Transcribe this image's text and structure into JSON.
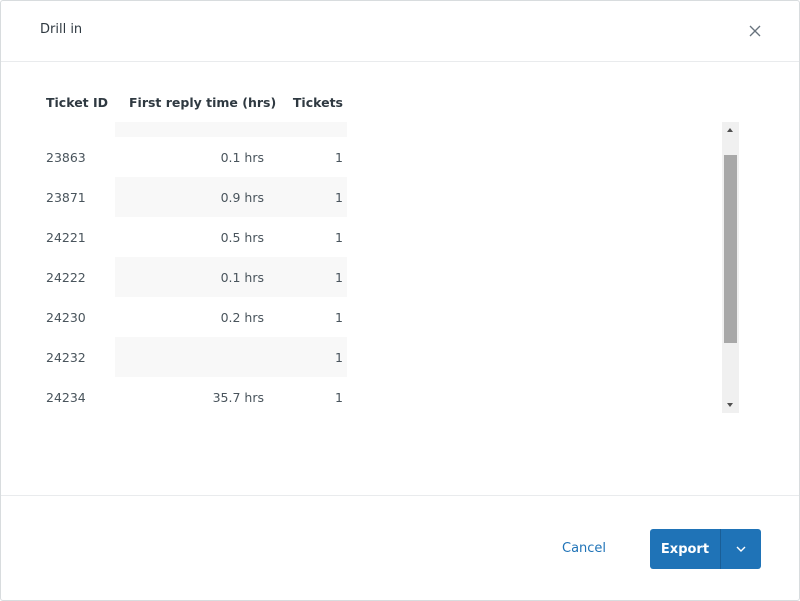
{
  "dialog": {
    "title": "Drill in",
    "close_icon": "close-icon"
  },
  "table": {
    "headers": {
      "ticket_id": "Ticket ID",
      "first_reply_time": "First reply time (hrs)",
      "tickets": "Tickets"
    },
    "rows": [
      {
        "ticket_id": "",
        "first_reply_time": "",
        "tickets": ""
      },
      {
        "ticket_id": "23863",
        "first_reply_time": "0.1 hrs",
        "tickets": "1"
      },
      {
        "ticket_id": "23871",
        "first_reply_time": "0.9 hrs",
        "tickets": "1"
      },
      {
        "ticket_id": "24221",
        "first_reply_time": "0.5 hrs",
        "tickets": "1"
      },
      {
        "ticket_id": "24222",
        "first_reply_time": "0.1 hrs",
        "tickets": "1"
      },
      {
        "ticket_id": "24230",
        "first_reply_time": "0.2 hrs",
        "tickets": "1"
      },
      {
        "ticket_id": "24232",
        "first_reply_time": "",
        "tickets": "1"
      },
      {
        "ticket_id": "24234",
        "first_reply_time": "35.7 hrs",
        "tickets": "1"
      }
    ]
  },
  "footer": {
    "cancel_label": "Cancel",
    "export_label": "Export",
    "export_menu_icon": "chevron-down-icon"
  },
  "colors": {
    "primary": "#1f73b7",
    "row_alt": "#f8f8f8",
    "text": "#2f3941"
  }
}
